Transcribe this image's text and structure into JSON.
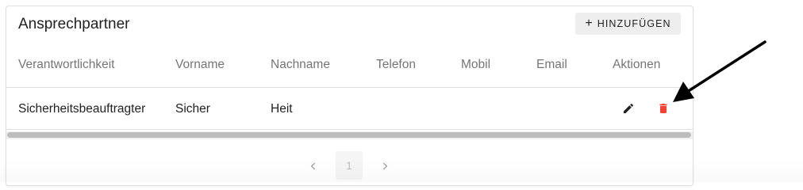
{
  "card": {
    "title": "Ansprechpartner",
    "add_button": {
      "icon": "plus-icon",
      "label": "HINZUFÜGEN"
    }
  },
  "table": {
    "headers": [
      "Verantwortlichkeit",
      "Vorname",
      "Nachname",
      "Telefon",
      "Mobil",
      "Email",
      "Aktionen"
    ],
    "rows": [
      {
        "verantwortlichkeit": "Sicherheitsbeauftragter",
        "vorname": "Sicher",
        "nachname": "Heit",
        "telefon": "",
        "mobil": "",
        "email": "",
        "actions": {
          "edit_icon": "pencil-icon",
          "delete_icon": "trash-icon"
        }
      }
    ]
  },
  "pagination": {
    "prev_icon": "chevron-left-icon",
    "current_page": "1",
    "next_icon": "chevron-right-icon"
  },
  "annotation": {
    "icon": "arrow-icon"
  },
  "colors": {
    "delete": "#f44336",
    "edit": "#212121",
    "header_text": "#757575",
    "button_bg": "#eeeeee"
  }
}
